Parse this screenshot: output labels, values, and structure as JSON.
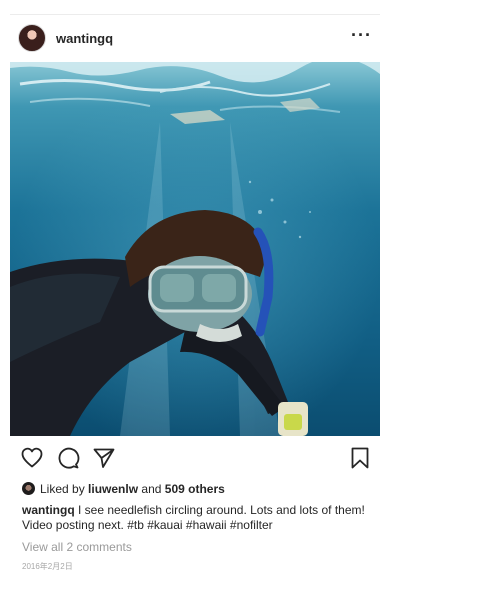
{
  "post": {
    "username": "wantingq",
    "more_label": "···",
    "liked_by_prefix": "Liked by",
    "liked_by_user": "liuwenlw",
    "liked_by_and": "and",
    "liked_by_others": "509 others",
    "caption_user": "wantingq",
    "caption_text": "I see needlefish circling around. Lots and lots of them! Video posting next. #tb #kauai #hawaii #nofilter",
    "view_comments": "View all 2 comments",
    "date": "2016年2月2日"
  },
  "icons": {
    "like": "heart-icon",
    "comment": "comment-icon",
    "share": "paper-plane-icon",
    "save": "bookmark-icon",
    "more": "more-horizontal-icon"
  },
  "colors": {
    "text": "#262626",
    "muted": "#9a9a9a",
    "water_top": "#6eb6c9",
    "water_deep": "#0a4a6c"
  }
}
